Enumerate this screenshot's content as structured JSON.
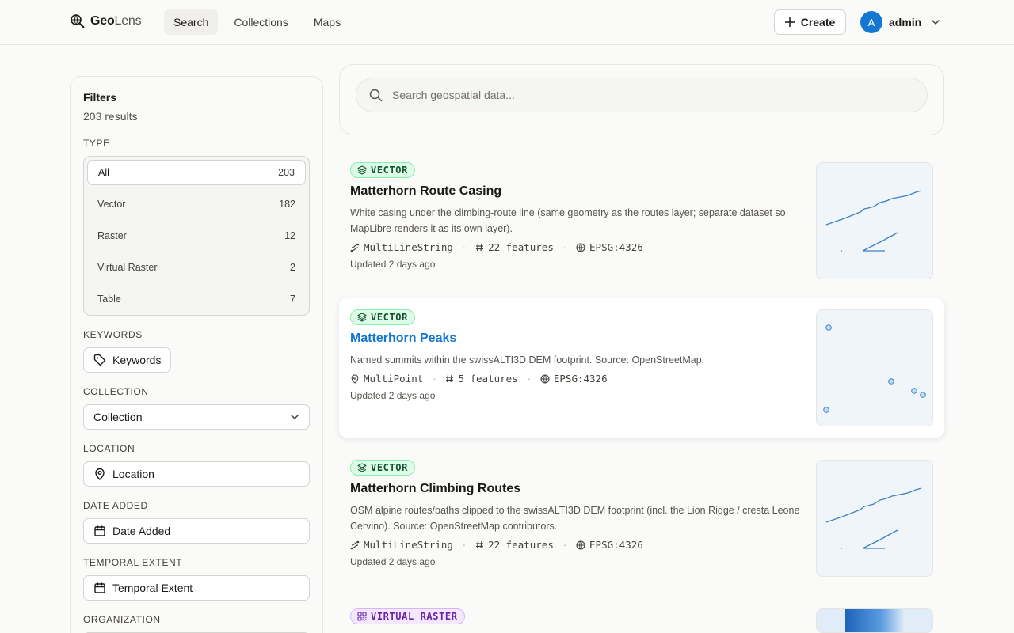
{
  "header": {
    "logo_bold": "Geo",
    "logo_light": "Lens",
    "nav": [
      "Search",
      "Collections",
      "Maps"
    ],
    "create_label": "Create",
    "avatar_initial": "A",
    "username": "admin"
  },
  "filters": {
    "title": "Filters",
    "results": "203 results",
    "type_label": "TYPE",
    "types": [
      {
        "label": "All",
        "count": "203"
      },
      {
        "label": "Vector",
        "count": "182"
      },
      {
        "label": "Raster",
        "count": "12"
      },
      {
        "label": "Virtual Raster",
        "count": "2"
      },
      {
        "label": "Table",
        "count": "7"
      }
    ],
    "keywords_label": "KEYWORDS",
    "keywords_btn": "Keywords",
    "collection_label": "COLLECTION",
    "collection_value": "Collection",
    "location_label": "LOCATION",
    "location_btn": "Location",
    "date_label": "DATE ADDED",
    "date_btn": "Date Added",
    "temporal_label": "TEMPORAL EXTENT",
    "temporal_btn": "Temporal Extent",
    "organization_label": "ORGANIZATION"
  },
  "search": {
    "placeholder": "Search geospatial data..."
  },
  "results": [
    {
      "badge": "VECTOR",
      "title": "Matterhorn Route Casing",
      "desc": "White casing under the climbing-route line (same geometry as the routes layer; separate dataset so MapLibre renders it as its own layer).",
      "geometry": "MultiLineString",
      "features": "22 features",
      "crs": "EPSG:4326",
      "updated": "Updated 2 days ago"
    },
    {
      "badge": "VECTOR",
      "title": "Matterhorn Peaks",
      "desc": "Named summits within the swissALTI3D DEM footprint. Source: OpenStreetMap.",
      "geometry": "MultiPoint",
      "features": "5 features",
      "crs": "EPSG:4326",
      "updated": "Updated 2 days ago"
    },
    {
      "badge": "VECTOR",
      "title": "Matterhorn Climbing Routes",
      "desc": "OSM alpine routes/paths clipped to the swissALTI3D DEM footprint (incl. the Lion Ridge / cresta Leone Cervino). Source: OpenStreetMap contributors.",
      "geometry": "MultiLineString",
      "features": "22 features",
      "crs": "EPSG:4326",
      "updated": "Updated 2 days ago"
    },
    {
      "badge": "VIRTUAL RASTER"
    }
  ],
  "colors": {
    "accent": "#1477d4",
    "vector_badge_bg": "#dcfce7",
    "virtual_raster_badge_bg": "#f3e8ff"
  }
}
